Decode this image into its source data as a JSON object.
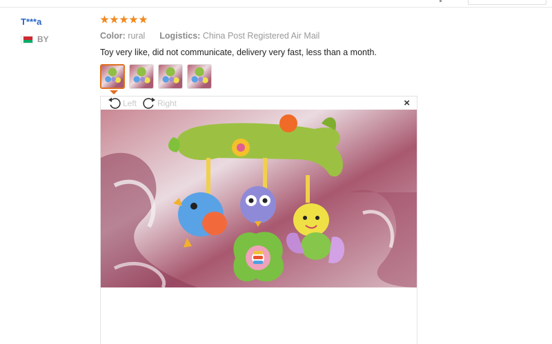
{
  "reviewer": {
    "name": "T***a",
    "country_code": "BY",
    "flag_colors": [
      "#d22730",
      "#00af66",
      "#ffffff"
    ]
  },
  "rating": {
    "stars": 5,
    "max": 5,
    "color": "#f2891f"
  },
  "attributes": {
    "color_label": "Color:",
    "color_value": "rural",
    "logistics_label": "Logistics:",
    "logistics_value": "China Post Registered Air Mail"
  },
  "review_text": "Toy very like, did not communicate, delivery very fast, less than a month.",
  "thumbnails": {
    "count": 4,
    "active_index": 0,
    "active_border_color": "#e07020"
  },
  "viewer": {
    "rotate_left_label": "Left",
    "rotate_right_label": "Right",
    "close_label": "×"
  }
}
